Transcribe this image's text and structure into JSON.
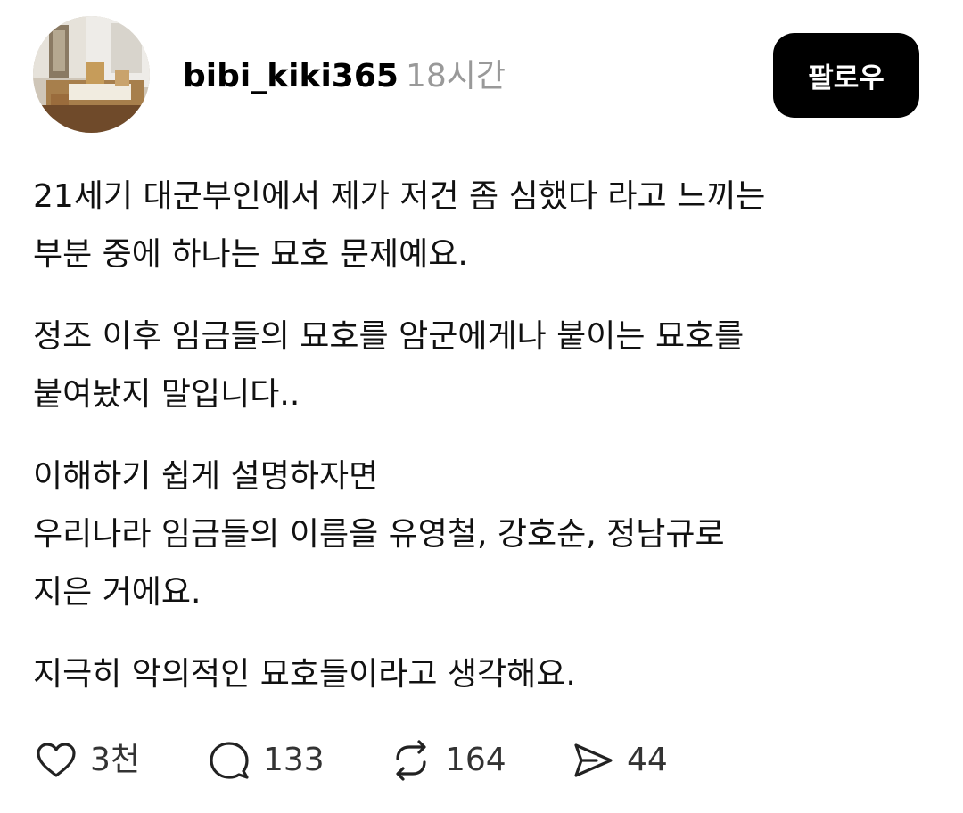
{
  "post": {
    "author": {
      "username": "bibi_kiki365",
      "time": "18시간"
    },
    "follow_label": "팔로우",
    "paragraphs": [
      {
        "lines": [
          "21세기 대군부인에서 제가 저건 좀 심했다 라고 느끼는",
          "부분 중에 하나는 묘호 문제예요."
        ]
      },
      {
        "lines": [
          "정조 이후 임금들의 묘호를 암군에게나 붙이는 묘호를",
          "붙여놨지 말입니다.."
        ]
      },
      {
        "lines": [
          "이해하기 쉽게 설명하자면",
          "우리나라 임금들의 이름을 유영철, 강호순, 정남규로",
          "지은 거에요."
        ]
      },
      {
        "lines": [
          "지극히 악의적인 묘호들이라고 생각해요."
        ]
      }
    ],
    "actions": {
      "like": {
        "icon": "heart-icon",
        "count": "3천"
      },
      "comment": {
        "icon": "comment-icon",
        "count": "133"
      },
      "repost": {
        "icon": "repost-icon",
        "count": "164"
      },
      "share": {
        "icon": "send-icon",
        "count": "44"
      }
    }
  }
}
